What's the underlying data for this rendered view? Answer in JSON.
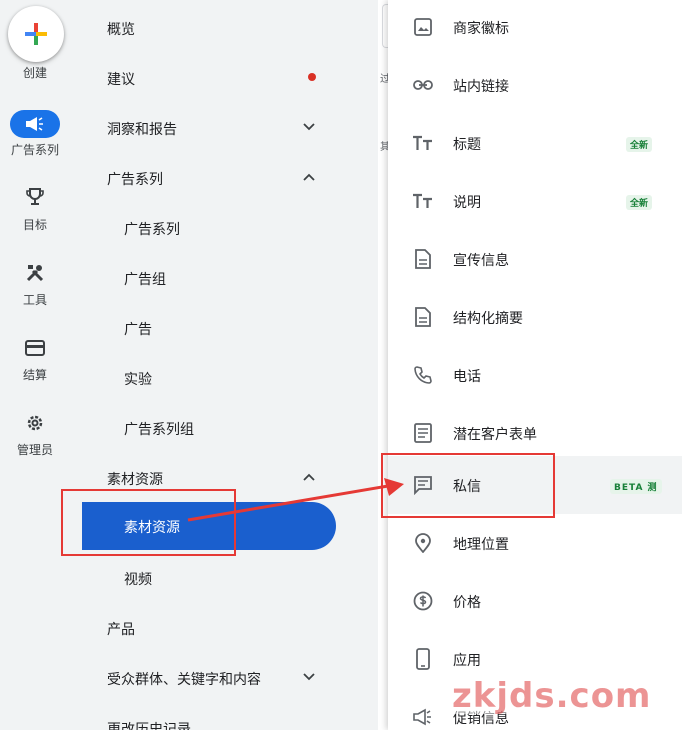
{
  "rail": {
    "create_label": "创建",
    "items": [
      {
        "icon": "megaphone-icon",
        "label": "广告系列",
        "active": true
      },
      {
        "icon": "trophy-icon",
        "label": "目标"
      },
      {
        "icon": "tools-icon",
        "label": "工具"
      },
      {
        "icon": "card-icon",
        "label": "结算"
      },
      {
        "icon": "gear-icon",
        "label": "管理员"
      }
    ]
  },
  "nav": {
    "items": [
      {
        "label": "概览"
      },
      {
        "label": "建议",
        "dot": true
      },
      {
        "label": "洞察和报告",
        "chevron": "down"
      },
      {
        "label": "广告系列",
        "chevron": "up"
      },
      {
        "label": "广告系列"
      },
      {
        "label": "广告组"
      },
      {
        "label": "广告"
      },
      {
        "label": "实验"
      },
      {
        "label": "广告系列组"
      },
      {
        "label": "素材资源",
        "chevron": "up"
      },
      {
        "label": "素材资源",
        "selected": true
      },
      {
        "label": "视频"
      },
      {
        "label": "产品"
      },
      {
        "label": "受众群体、关键字和内容",
        "chevron": "down"
      },
      {
        "label": "更改历史记录"
      }
    ]
  },
  "sliver_chars": [
    "过",
    "其"
  ],
  "panel": {
    "items": [
      {
        "icon": "image-icon",
        "label": "商家徽标"
      },
      {
        "icon": "link-icon",
        "label": "站内链接"
      },
      {
        "icon": "text-icon",
        "label": "标题",
        "badge": "全新"
      },
      {
        "icon": "text-icon",
        "label": "说明",
        "badge": "全新"
      },
      {
        "icon": "document-icon",
        "label": "宣传信息"
      },
      {
        "icon": "document-icon",
        "label": "结构化摘要"
      },
      {
        "icon": "phone-icon",
        "label": "电话"
      },
      {
        "icon": "form-icon",
        "label": "潜在客户表单"
      },
      {
        "icon": "message-icon",
        "label": "私信",
        "badge": "BETA 测"
      },
      {
        "icon": "location-icon",
        "label": "地理位置"
      },
      {
        "icon": "price-icon",
        "label": "价格"
      },
      {
        "icon": "mobile-icon",
        "label": "应用"
      },
      {
        "icon": "promotion-icon",
        "label": "促销信息"
      }
    ]
  },
  "colors": {
    "accent": "#1a73e8",
    "selected": "#1a5fce",
    "annotation": "#e53935",
    "badge": "#188038"
  },
  "watermark": "zkjds.com"
}
